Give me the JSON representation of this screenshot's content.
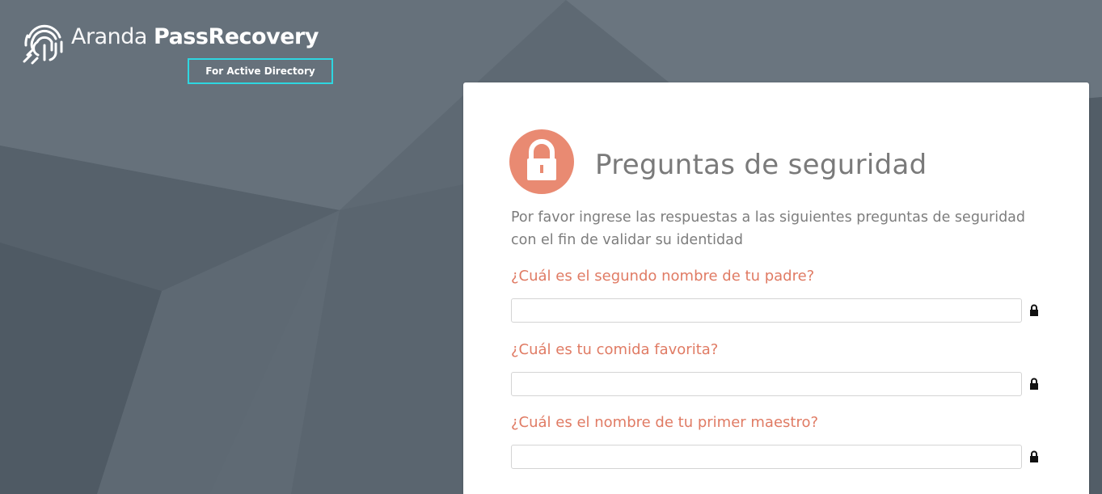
{
  "brand": {
    "name_light": "Aranda",
    "name_bold": "PassRecovery",
    "subtitle": "For Active Directory",
    "highlight_color": "#2ed6e0"
  },
  "card": {
    "title": "Preguntas de seguridad",
    "description": "Por favor ingrese las respuestas a las siguientes preguntas de seguridad con el fin de validar su identidad",
    "header_icon": "lock-icon",
    "accent_color": "#e98a72"
  },
  "questions": [
    {
      "label": "¿Cuál es el segundo nombre de tu padre?",
      "value": "",
      "icon": "lock-icon"
    },
    {
      "label": "¿Cuál es tu comida favorita?",
      "value": "",
      "icon": "lock-icon"
    },
    {
      "label": "¿Cuál es el nombre de tu primer maestro?",
      "value": "",
      "icon": "lock-icon"
    }
  ]
}
